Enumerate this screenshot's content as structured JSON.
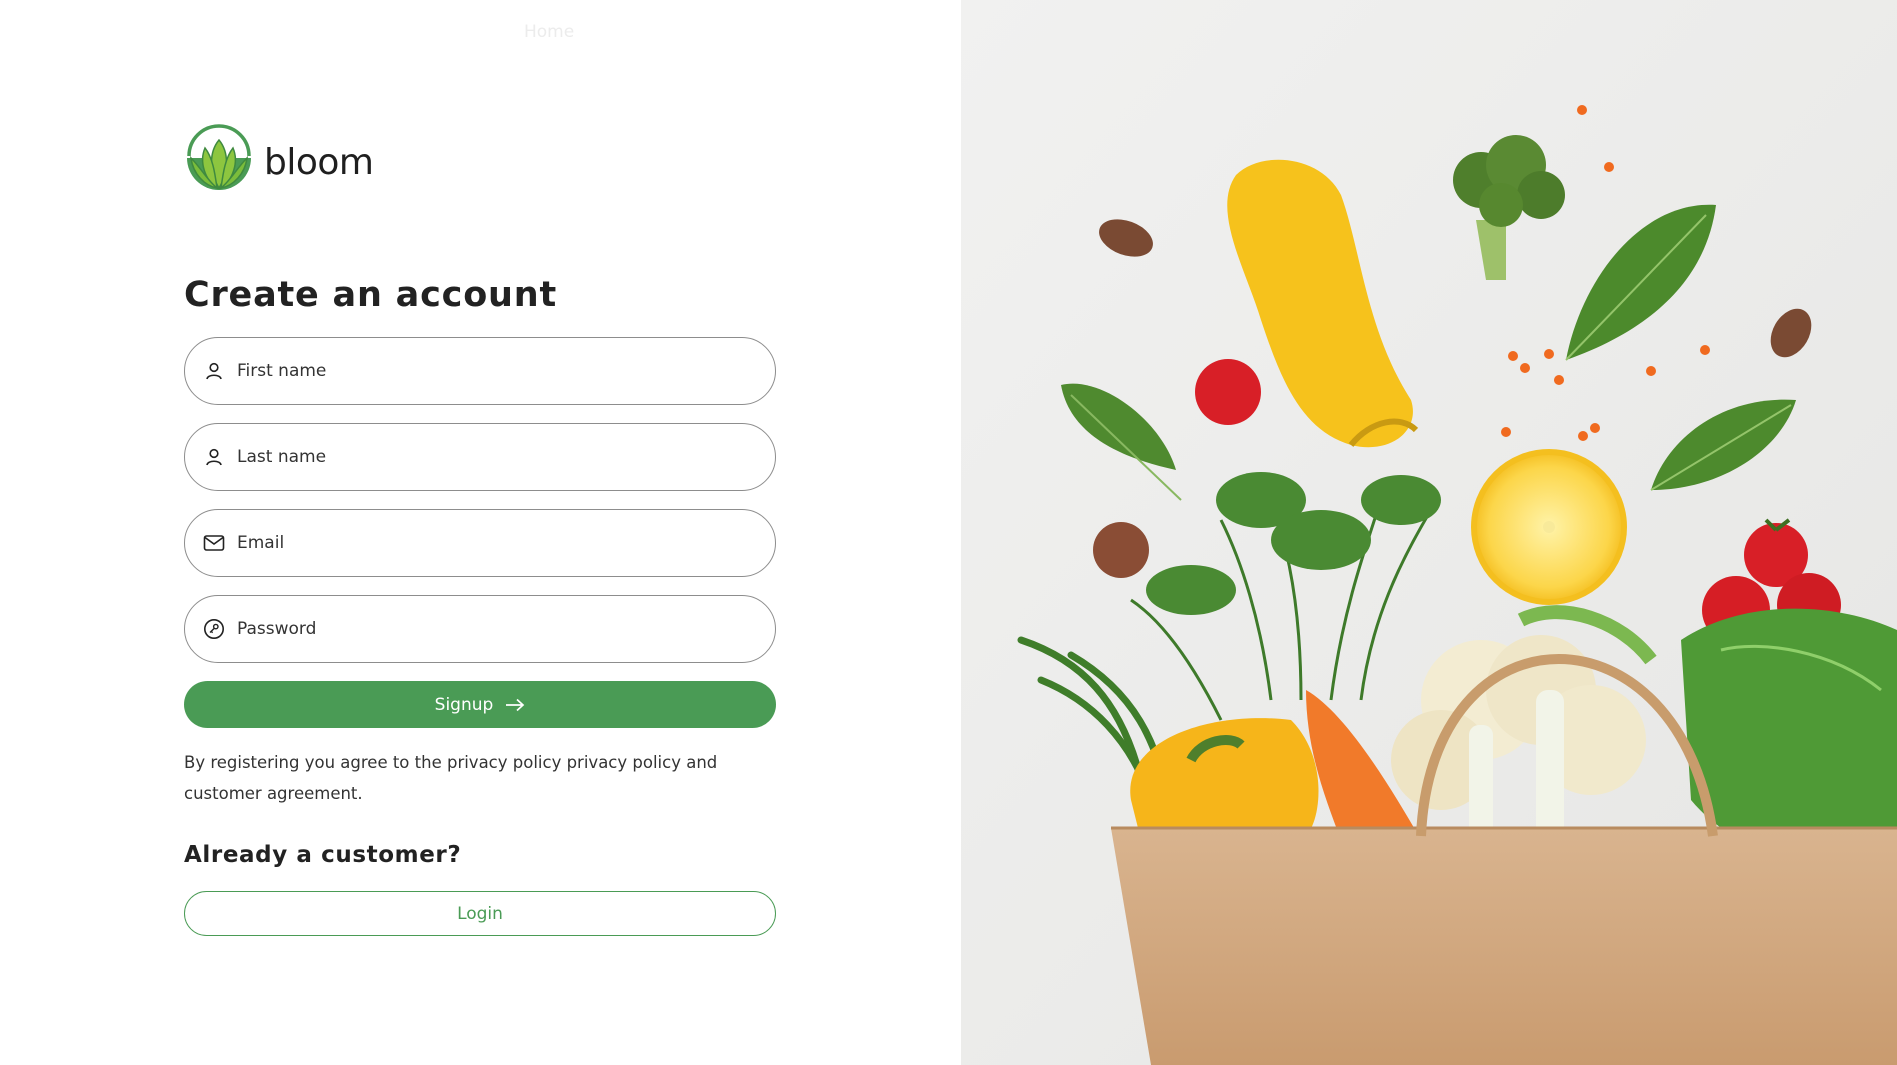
{
  "nav": {
    "home_label": "Home"
  },
  "brand": {
    "name": "bloom",
    "green": "#4a9b55"
  },
  "form": {
    "title": "Create an account",
    "first_name_placeholder": "First name",
    "last_name_placeholder": "Last name",
    "email_placeholder": "Email",
    "password_placeholder": "Password",
    "signup_label": "Signup",
    "terms_text": "By registering you agree to the privacy policy privacy policy and customer agreement."
  },
  "existing": {
    "heading": "Already a customer?",
    "login_label": "Login"
  },
  "hero": {
    "image_subject": "grocery-bag-with-vegetables"
  }
}
